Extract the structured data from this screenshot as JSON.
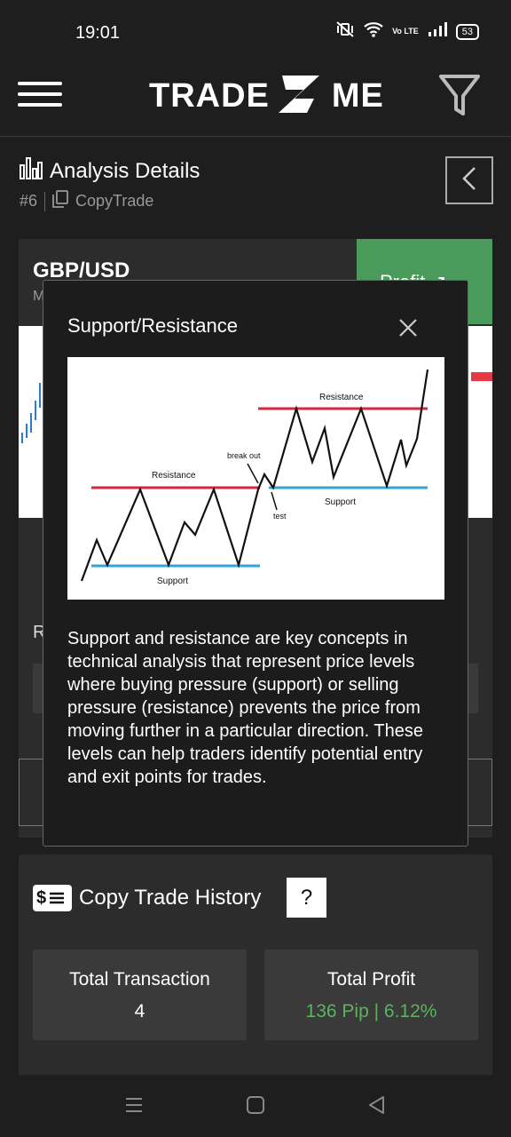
{
  "status": {
    "time": "19:01",
    "battery": "53",
    "volte": "Vo LTE"
  },
  "header": {
    "logo_left": "TRADE",
    "logo_right": "ME"
  },
  "analysis": {
    "title": "Analysis Details",
    "id": "#6",
    "type": "CopyTrade"
  },
  "card": {
    "pair": "GBP/USD",
    "pair_sub": "M",
    "profit_tab": "Profit ↗",
    "row_letter": "R"
  },
  "modal": {
    "title": "Support/Resistance",
    "body": "Support and resistance are key concepts in technical analysis that represent price levels where buying pressure (support) or selling pressure (resistance) prevents the price from moving further in a particular direction. These levels can help traders identify potential entry and exit points for trades.",
    "image_labels": {
      "resistance_top": "Resistance",
      "resistance_left": "Resistance",
      "support_left": "Support",
      "support_right": "Support",
      "break_out": "break out",
      "test": "test"
    }
  },
  "history": {
    "title": "Copy Trade History",
    "help": "?",
    "dollar_icon_text": "$",
    "total_transaction_label": "Total Transaction",
    "total_transaction_value": "4",
    "total_profit_label": "Total Profit",
    "total_profit_value": "136 Pip | 6.12%"
  },
  "colors": {
    "profit_green": "#4a9a5b",
    "profit_text": "#5cb35f",
    "resistance": "#d7263d",
    "support": "#2fa4d6"
  }
}
